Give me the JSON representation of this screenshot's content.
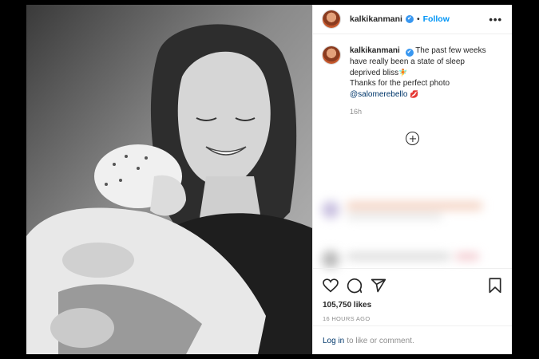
{
  "post": {
    "username": "kalkikanmani",
    "verified_glyph": "✔",
    "separator": "•",
    "follow_label": "Follow",
    "more_label": "•••",
    "photo_alt": "photo"
  },
  "caption": {
    "username": "kalkikanmani",
    "line1": "The past few weeks have really been a state of sleep deprived bliss",
    "line1_emoji": "🧚",
    "line2": "Thanks for the perfect photo",
    "mention": "@salomerebello",
    "mention_emoji": "💋",
    "time": "16h"
  },
  "actions": {
    "likes": "105,750 likes",
    "posted": "16 HOURS AGO"
  },
  "footer": {
    "login_link": "Log in",
    "login_text": "to like or comment."
  },
  "colors": {
    "accent": "#0095f6",
    "heart_stroke": "#262626",
    "muted": "#8e8e8e"
  },
  "icons": [
    "heart-icon",
    "comment-icon",
    "share-icon",
    "bookmark-icon",
    "add-comment-icon",
    "more-icon",
    "verified-icon"
  ]
}
